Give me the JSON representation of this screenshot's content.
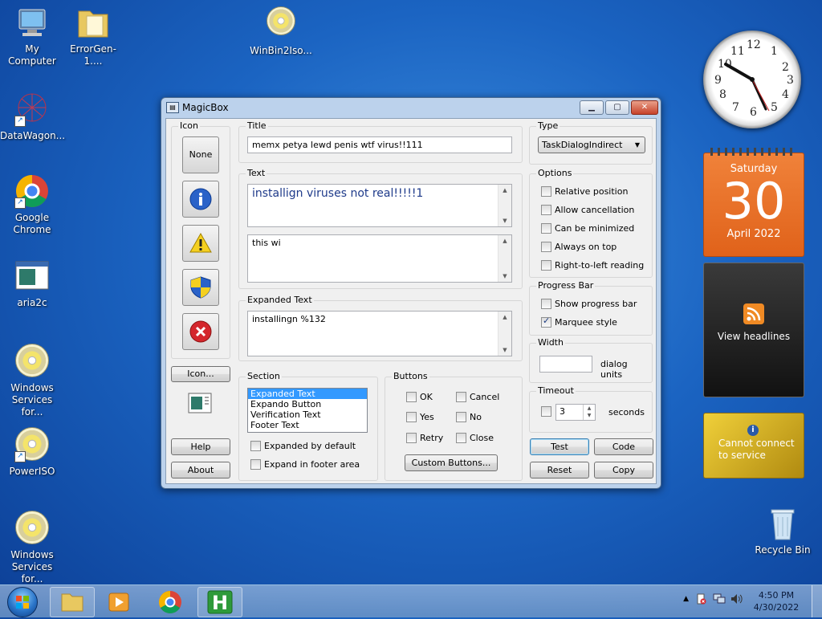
{
  "desktop": {
    "icons": [
      {
        "label": "My Computer"
      },
      {
        "label": "ErrorGen-1...."
      },
      {
        "label": "WinBin2Iso..."
      },
      {
        "label": "DataWagon..."
      },
      {
        "label": "Google Chrome"
      },
      {
        "label": "aria2c"
      },
      {
        "label": "Windows Services for..."
      },
      {
        "label": "PowerISO"
      },
      {
        "label": "Windows Services for..."
      },
      {
        "label": "Recycle Bin"
      }
    ]
  },
  "window": {
    "title": "MagicBox",
    "icon_group_label": "Icon",
    "icon_buttons": {
      "none_label": "None"
    },
    "icon_browse_label": "Icon...",
    "help_label": "Help",
    "about_label": "About",
    "title_group_label": "Title",
    "title_value": "memx petya lewd penis wtf virus!!111",
    "text_group_label": "Text",
    "text_value": "installign viruses not real!!!!!1",
    "text2_value": "this wi",
    "expanded_group_label": "Expanded Text",
    "expanded_value": "installingn %132",
    "section_group_label": "Section",
    "section_items": [
      "Expanded Text",
      "Expando Button",
      "Verification Text",
      "Footer Text"
    ],
    "section_selected": "Expanded Text",
    "expanded_by_default_label": "Expanded by default",
    "expand_in_footer_label": "Expand in footer area",
    "buttons_group_label": "Buttons",
    "button_checks": {
      "ok": "OK",
      "cancel": "Cancel",
      "yes": "Yes",
      "no": "No",
      "retry": "Retry",
      "close": "Close"
    },
    "custom_buttons_label": "Custom Buttons...",
    "type_group_label": "Type",
    "type_value": "TaskDialogIndirect",
    "options_group_label": "Options",
    "options": {
      "relative_position": "Relative position",
      "allow_cancellation": "Allow cancellation",
      "can_be_minimized": "Can be minimized",
      "always_on_top": "Always on top",
      "rtl_reading": "Right-to-left reading"
    },
    "progress_group_label": "Progress Bar",
    "show_progress_label": "Show progress bar",
    "marquee_label": "Marquee style",
    "marquee_checked": true,
    "width_group_label": "Width",
    "width_value": "",
    "dialog_units_label": "dialog units",
    "timeout_group_label": "Timeout",
    "timeout_value": "3",
    "seconds_label": "seconds",
    "test_label": "Test",
    "code_label": "Code",
    "reset_label": "Reset",
    "copy_label": "Copy"
  },
  "gadgets": {
    "calendar_day": "Saturday",
    "calendar_date": "30",
    "calendar_month": "April 2022",
    "rss_label": "View headlines",
    "weather_text": "Cannot connect to service"
  },
  "taskbar": {
    "time": "4:50 PM",
    "date": "4/30/2022"
  }
}
